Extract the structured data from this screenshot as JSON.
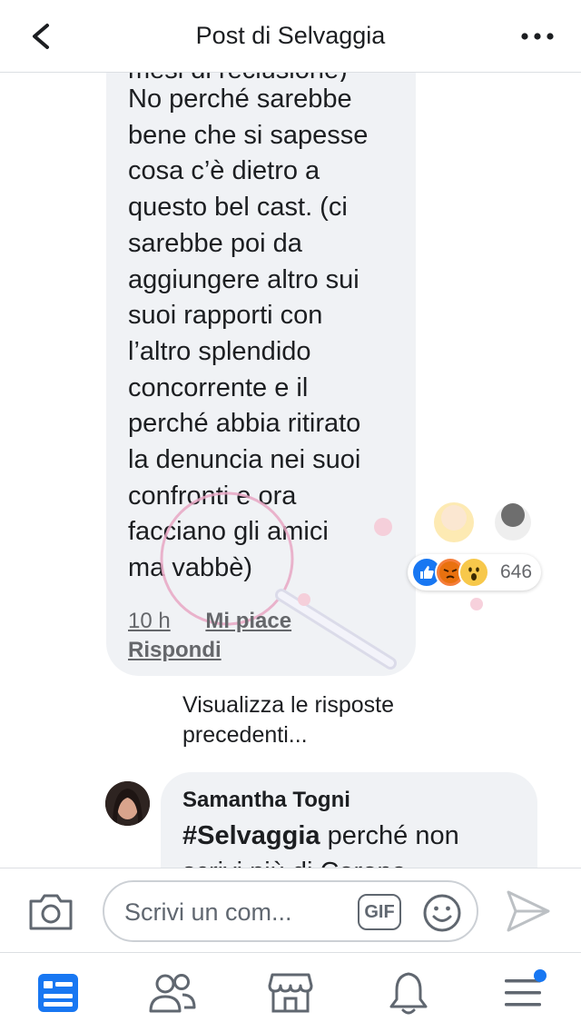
{
  "header": {
    "title": "Post di Selvaggia",
    "back_icon": "chevron-left-icon",
    "more_icon": "more-horizontal-icon"
  },
  "comment": {
    "partial_line": "mesi di reclusione)",
    "lines": [
      "No perché sarebbe",
      "bene che si sapesse",
      "cosa c’è dietro a",
      "questo bel cast. (ci",
      "sarebbe poi da",
      "aggiungere altro sui",
      "suoi rapporti con",
      "l’altro splendido",
      "concorrente e il",
      "perché abbia ritirato",
      "la denuncia nei suoi",
      "confronti e ora",
      "facciano gli amici",
      "ma vabbè)"
    ],
    "reaction_count": "646",
    "reaction_icons": [
      "like-icon",
      "angry-icon",
      "wow-icon"
    ],
    "time": "10 h",
    "like_label": "Mi piace",
    "reply_label": "Rispondi"
  },
  "previous_replies": "Visualizza le risposte precedenti...",
  "reply_comment": {
    "author": "Samantha Togni",
    "hashtag": "#Selvaggia",
    "text_line1": " perché non",
    "text_line2": "scrivi più di Corona"
  },
  "composer": {
    "placeholder": "Scrivi un com...",
    "gif_label": "GIF"
  },
  "colors": {
    "accent": "#1877f2",
    "bubble": "#f0f2f5",
    "secondary_text": "#65676b"
  }
}
